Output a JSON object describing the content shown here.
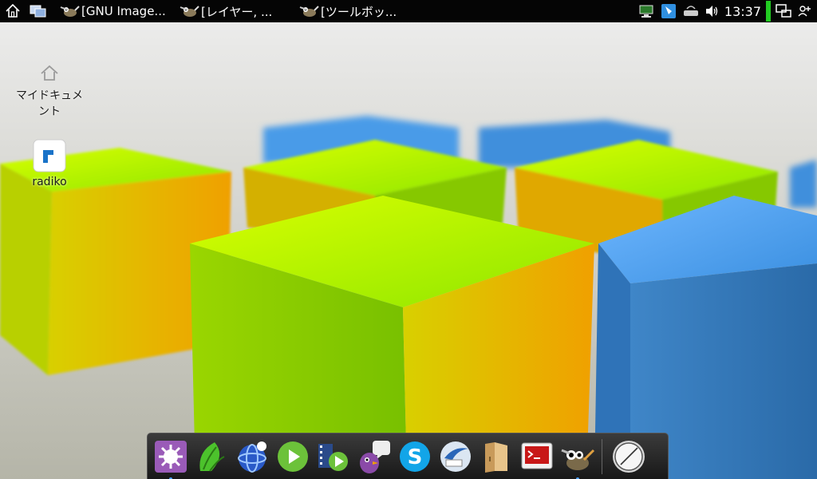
{
  "top_panel": {
    "tasks": [
      {
        "label": "[GNU Image..."
      },
      {
        "label": "[レイヤー, ..."
      },
      {
        "label": "[ツールボッ..."
      }
    ],
    "clock": "13:37"
  },
  "desktop": {
    "icons": [
      {
        "label": "マイドキュメント"
      },
      {
        "label": "radiko"
      }
    ]
  },
  "dock": {
    "items": [
      {
        "icon": "settings-icon",
        "running": true
      },
      {
        "icon": "leaf-browser-icon",
        "running": false
      },
      {
        "icon": "web-globe-icon",
        "running": false
      },
      {
        "icon": "media-play-icon",
        "running": false
      },
      {
        "icon": "video-player-icon",
        "running": false
      },
      {
        "icon": "pidgin-chat-icon",
        "running": false
      },
      {
        "icon": "skype-icon",
        "running": false
      },
      {
        "icon": "mail-client-icon",
        "running": false
      },
      {
        "icon": "file-manager-icon",
        "running": false
      },
      {
        "icon": "terminal-icon",
        "running": false
      },
      {
        "icon": "gimp-icon",
        "running": true
      },
      {
        "icon": "clock-icon",
        "running": false
      }
    ]
  },
  "colors": {
    "panel_bg": "#050505",
    "accent_green": "#22cc22",
    "dock_bg": "#222222"
  }
}
